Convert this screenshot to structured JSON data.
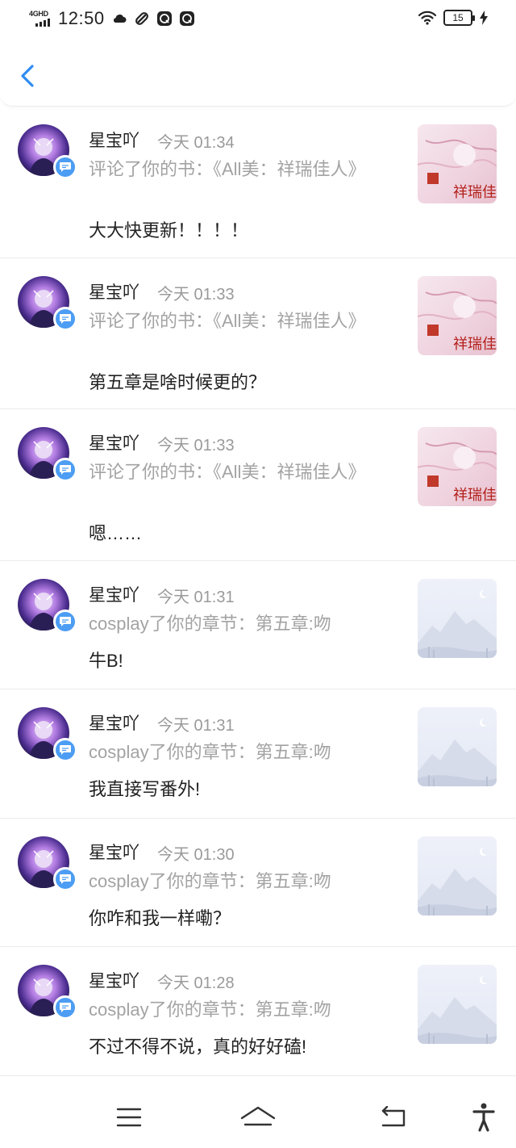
{
  "status_bar": {
    "network": "4GHD",
    "time": "12:50",
    "battery": "15"
  },
  "notifications": [
    {
      "user": "星宝吖",
      "time": "今天 01:34",
      "action": "评论了你的书：《All美：祥瑞佳人》",
      "comment": "大大快更新！！！！",
      "thumb_type": "book-cover"
    },
    {
      "user": "星宝吖",
      "time": "今天 01:33",
      "action": "评论了你的书：《All美：祥瑞佳人》",
      "comment": "第五章是啥时候更的？",
      "thumb_type": "book-cover"
    },
    {
      "user": "星宝吖",
      "time": "今天 01:33",
      "action": "评论了你的书：《All美：祥瑞佳人》",
      "comment": "嗯……",
      "thumb_type": "book-cover"
    },
    {
      "user": "星宝吖",
      "time": "今天 01:31",
      "action": "cosplay了你的章节：第五章:吻",
      "comment": "牛B!",
      "thumb_type": "placeholder"
    },
    {
      "user": "星宝吖",
      "time": "今天 01:31",
      "action": "cosplay了你的章节：第五章:吻",
      "comment": "我直接写番外!",
      "thumb_type": "placeholder"
    },
    {
      "user": "星宝吖",
      "time": "今天 01:30",
      "action": "cosplay了你的章节：第五章:吻",
      "comment": "你咋和我一样嘞？",
      "thumb_type": "placeholder"
    },
    {
      "user": "星宝吖",
      "time": "今天 01:28",
      "action": "cosplay了你的章节：第五章:吻",
      "comment": "不过不得不说，真的好好磕!",
      "thumb_type": "placeholder"
    }
  ],
  "book_cover": {
    "title": "祥瑞佳人",
    "tag": "All美"
  },
  "colors": {
    "accent": "#2f8cf0",
    "badge": "#4c9df3",
    "muted_text": "#a3a3a3"
  },
  "nav": [
    "menu-icon",
    "home-icon",
    "back-icon",
    "accessibility-icon"
  ]
}
